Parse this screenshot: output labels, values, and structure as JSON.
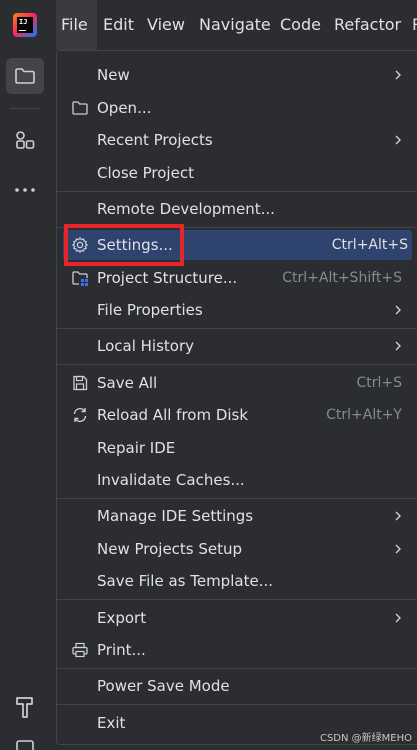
{
  "menubar": {
    "items": [
      "File",
      "Edit",
      "View",
      "Navigate",
      "Code",
      "Refactor",
      "R"
    ]
  },
  "file_menu": {
    "new": {
      "label": "New"
    },
    "open": {
      "label": "Open..."
    },
    "recent_projects": {
      "label": "Recent Projects"
    },
    "close_project": {
      "label": "Close Project"
    },
    "remote_development": {
      "label": "Remote Development..."
    },
    "settings": {
      "label": "Settings...",
      "shortcut": "Ctrl+Alt+S"
    },
    "project_structure": {
      "label": "Project Structure...",
      "shortcut": "Ctrl+Alt+Shift+S"
    },
    "file_properties": {
      "label": "File Properties"
    },
    "local_history": {
      "label": "Local History"
    },
    "save_all": {
      "label": "Save All",
      "shortcut": "Ctrl+S"
    },
    "reload_all": {
      "label": "Reload All from Disk",
      "shortcut": "Ctrl+Alt+Y"
    },
    "repair_ide": {
      "label": "Repair IDE"
    },
    "invalidate_caches": {
      "label": "Invalidate Caches..."
    },
    "manage_ide_settings": {
      "label": "Manage IDE Settings"
    },
    "new_projects_setup": {
      "label": "New Projects Setup"
    },
    "save_as_template": {
      "label": "Save File as Template..."
    },
    "export": {
      "label": "Export"
    },
    "print": {
      "label": "Print..."
    },
    "power_save_mode": {
      "label": "Power Save Mode"
    },
    "exit": {
      "label": "Exit"
    }
  },
  "logo_text": "IJ",
  "watermark": "CSDN @新绿MEHO",
  "colors": {
    "selection": "#2e436e",
    "highlight_box": "#e5252a",
    "background": "#2b2d30"
  }
}
